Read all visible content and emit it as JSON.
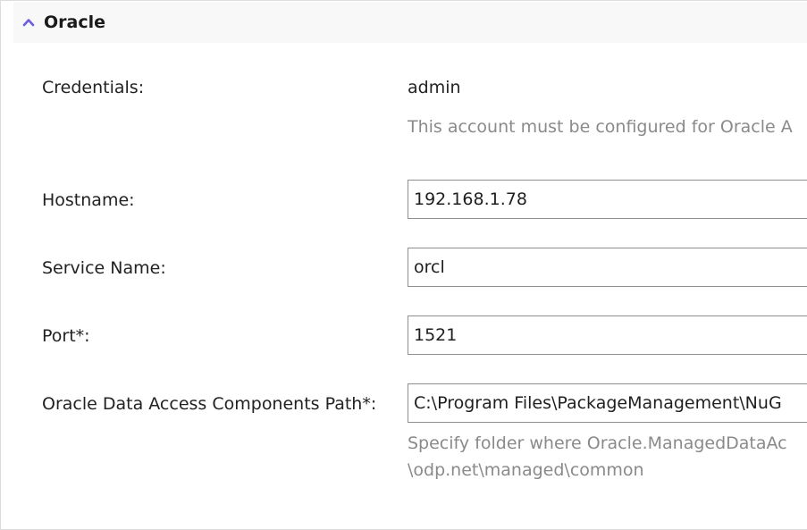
{
  "section": {
    "title": "Oracle",
    "chevron_icon": "chevron-up-icon",
    "accent_color": "#6b5ce7"
  },
  "credentials": {
    "label": "Credentials:",
    "value": "admin",
    "hint": "This account must be configured for Oracle A"
  },
  "hostname": {
    "label": "Hostname:",
    "value": "192.168.1.78"
  },
  "service_name": {
    "label": "Service Name:",
    "value": "orcl"
  },
  "port": {
    "label": "Port*:",
    "value": "1521"
  },
  "odac_path": {
    "label": "Oracle Data Access Components Path*:",
    "value": "C:\\Program Files\\PackageManagement\\NuG",
    "hint_line1": "Specify folder where Oracle.ManagedDataAc",
    "hint_line2": "\\odp.net\\managed\\common"
  }
}
